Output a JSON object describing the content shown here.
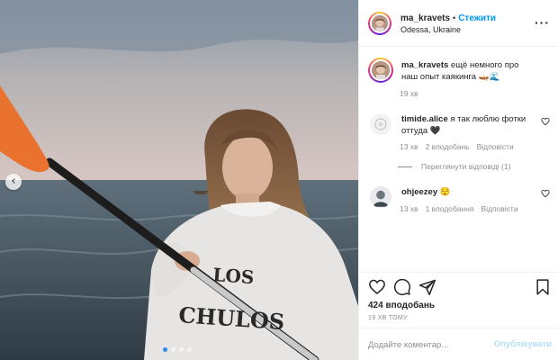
{
  "post": {
    "username": "ma_kravets",
    "separator": "•",
    "follow_label": "Стежити",
    "location": "Odessa, Ukraine",
    "more_label": "···",
    "caption": {
      "username": "ma_kravets",
      "text": "ещё немного про наш опыт каякинга 🛶🌊",
      "time": "19 хв"
    },
    "photo": {
      "prev_label": "‹",
      "slide_count": 4,
      "active_slide": 0,
      "sweatshirt_text_1": "LOS",
      "sweatshirt_text_2": "CHULOS"
    }
  },
  "comments": [
    {
      "username": "timide.alice",
      "text": "я так люблю фотки оттуда 🖤",
      "time": "13 хв",
      "likes": "2 вподобань",
      "reply_label": "Відповісти",
      "view_replies": "Переглянути відповіді (1)"
    },
    {
      "username": "ohjeezey",
      "text": "😌",
      "time": "13 хв",
      "likes": "1 вподобання",
      "reply_label": "Відповісти"
    }
  ],
  "actions": {
    "icons": [
      "heart-icon",
      "comment-icon",
      "share-icon",
      "bookmark-icon"
    ],
    "likes": "424 вподобань",
    "date": "19 ХВ ТОМУ"
  },
  "add_comment": {
    "placeholder": "Додайте коментар...",
    "publish_label": "Опублікувати"
  },
  "colors": {
    "accent": "#0095f6",
    "publish_disabled": "#b2dffc",
    "muted": "#8e8e8e",
    "border": "#efefef",
    "paddle_blade": "#e8722e"
  }
}
